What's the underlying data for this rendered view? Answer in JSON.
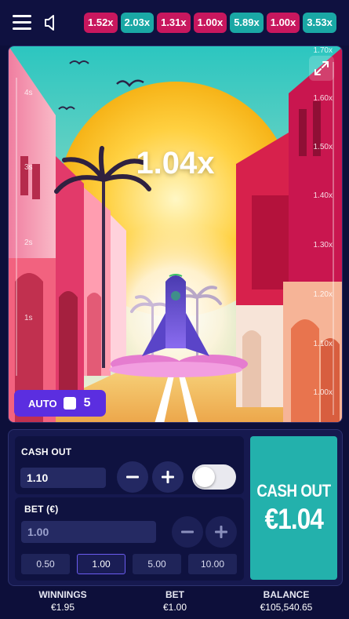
{
  "history": [
    {
      "value": "1.52x",
      "color": "pink"
    },
    {
      "value": "2.03x",
      "color": "teal"
    },
    {
      "value": "1.31x",
      "color": "pink"
    },
    {
      "value": "1.00x",
      "color": "pink"
    },
    {
      "value": "5.89x",
      "color": "teal"
    },
    {
      "value": "1.00x",
      "color": "pink"
    },
    {
      "value": "3.53x",
      "color": "teal"
    }
  ],
  "game": {
    "multiplier": "1.04x",
    "time_labels": [
      "4s",
      "3s",
      "2s",
      "1s"
    ],
    "multiplier_labels": [
      "1.70x",
      "1.60x",
      "1.50x",
      "1.40x",
      "1.30x",
      "1.20x",
      "1.10x",
      "1.00x"
    ],
    "auto": {
      "label": "AUTO",
      "count": "5"
    }
  },
  "cashout_panel": {
    "label": "CASH OUT",
    "value": "1.10"
  },
  "bet_panel": {
    "label": "BET (€)",
    "value": "1.00",
    "quick_amounts": [
      "0.50",
      "1.00",
      "5.00",
      "10.00"
    ],
    "selected": "1.00"
  },
  "cashout_button": {
    "title": "CASH OUT",
    "amount": "€1.04"
  },
  "footer": {
    "winnings_label": "WINNINGS",
    "winnings_value": "€1.95",
    "bet_label": "BET",
    "bet_value": "€1.00",
    "balance_label": "BALANCE",
    "balance_value": "€105,540.65"
  },
  "colors": {
    "pink": "#c8175e",
    "teal": "#1aa8a5",
    "accent_purple": "#5b2ee0",
    "cashout": "#23b1ac"
  }
}
